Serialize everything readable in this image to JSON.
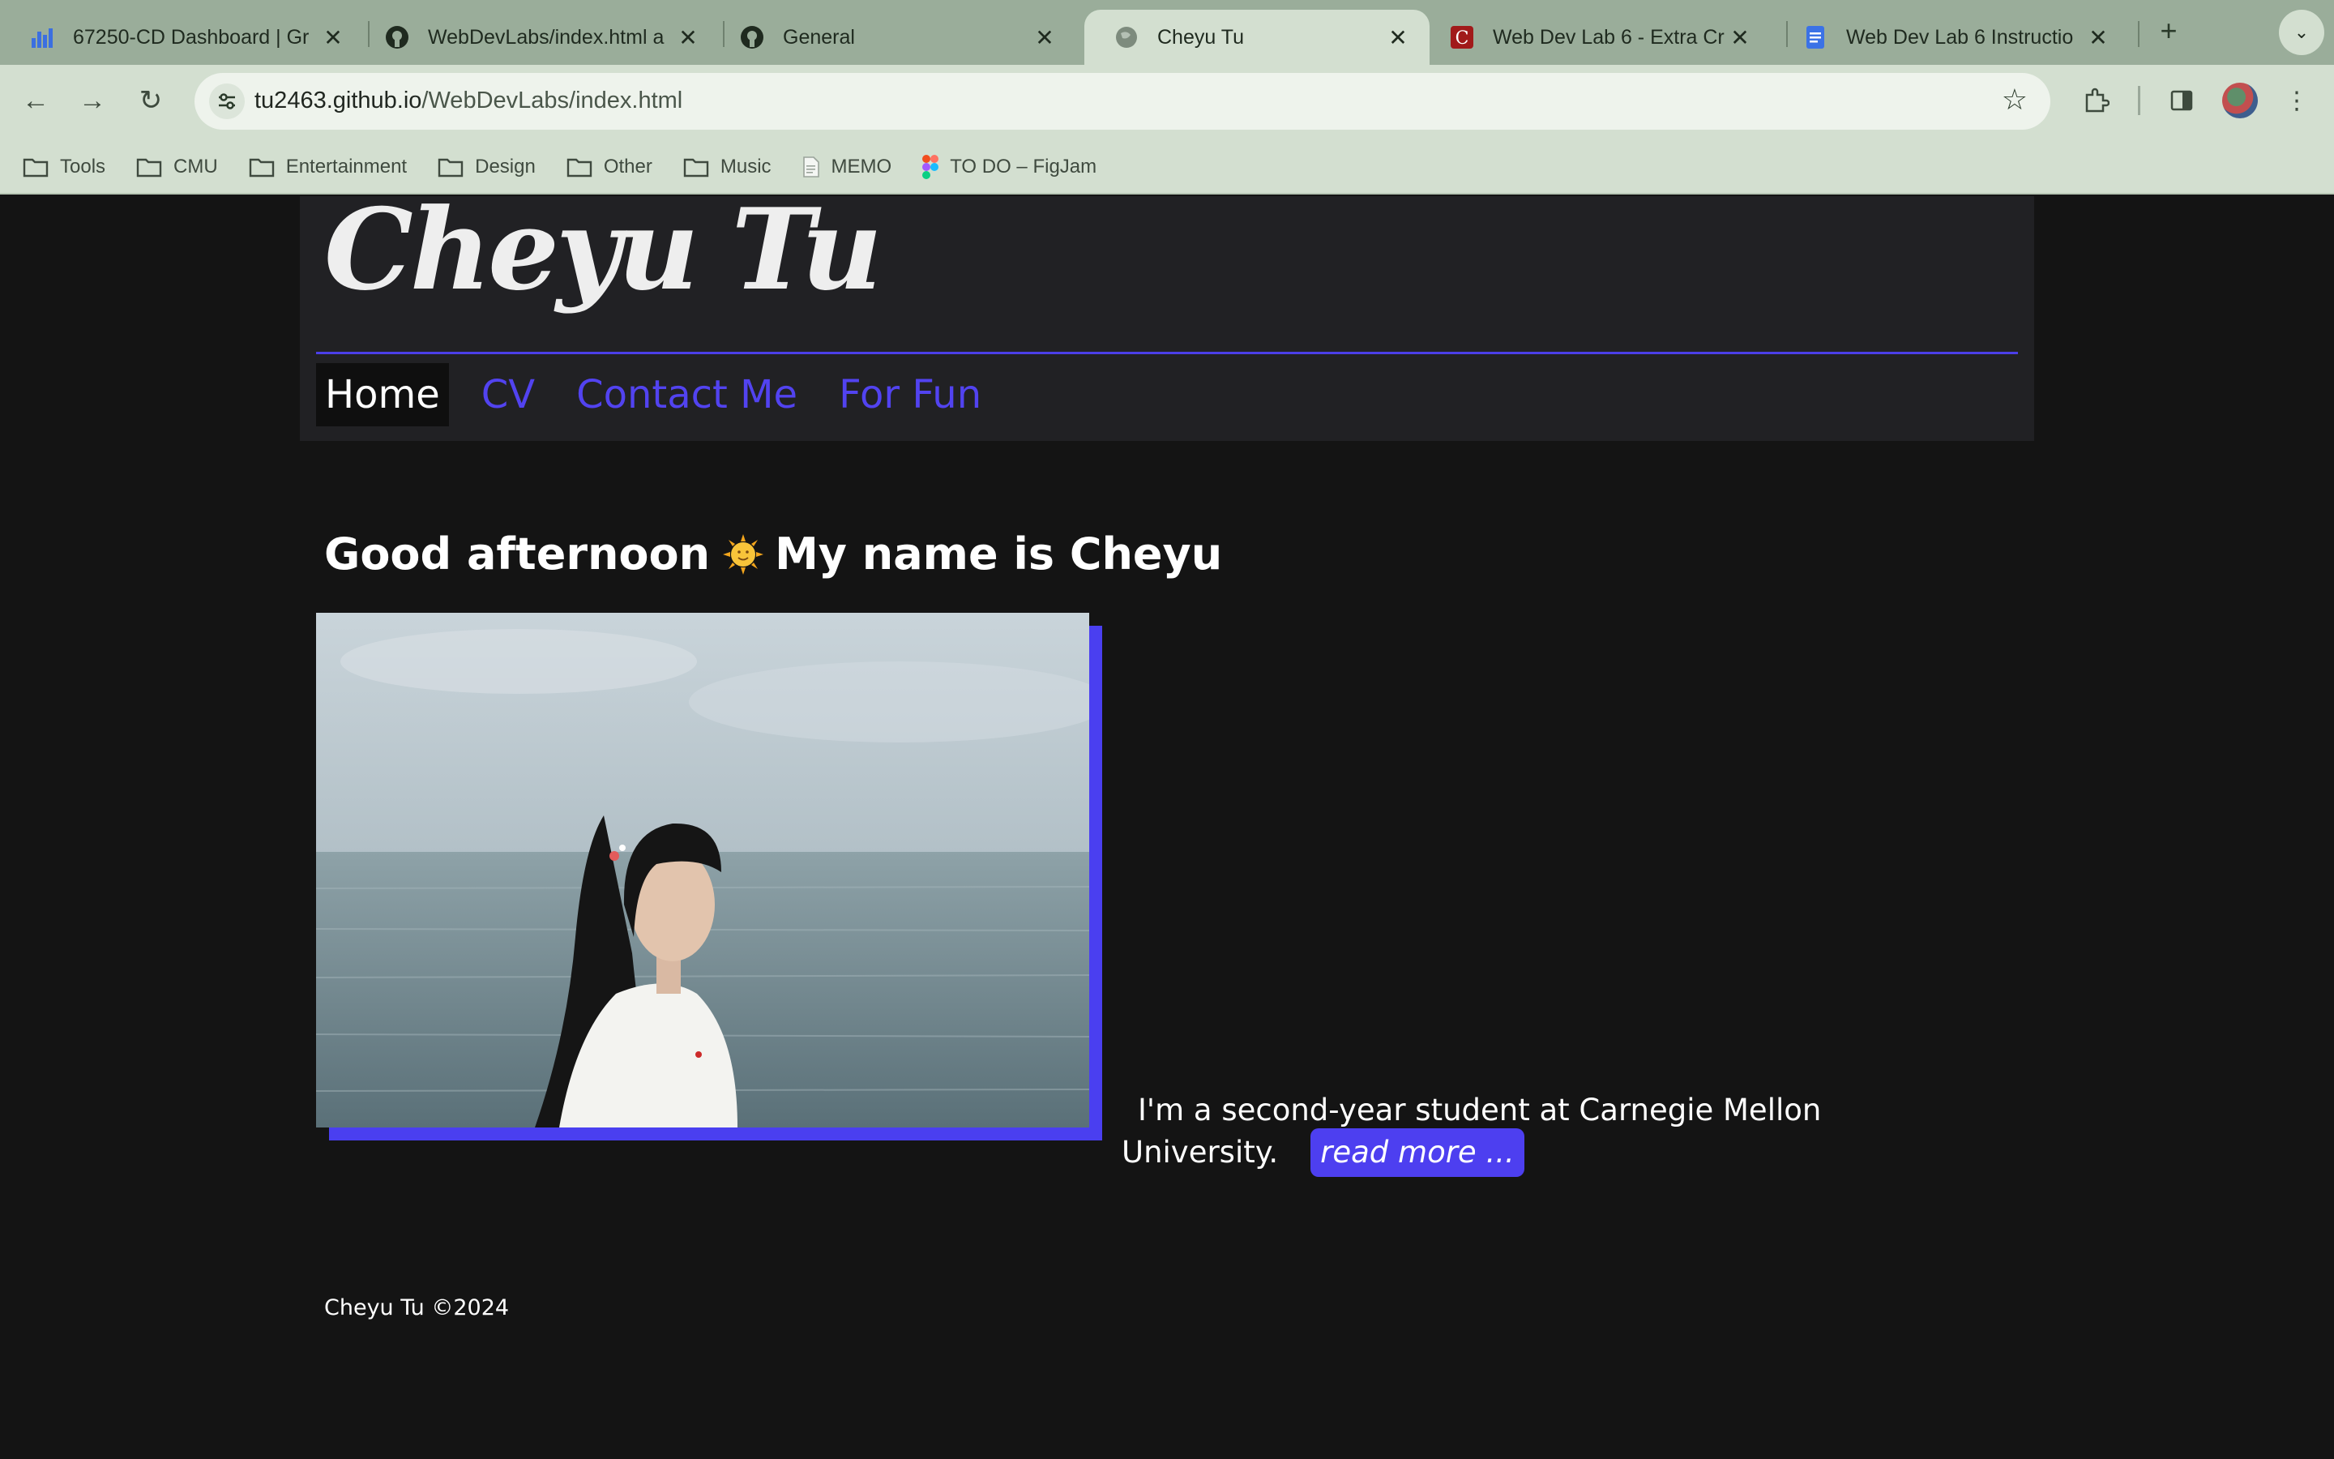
{
  "browser": {
    "tabs": [
      {
        "title": "67250-CD Dashboard | Gr",
        "icon": "bar-chart-icon"
      },
      {
        "title": "WebDevLabs/index.html a",
        "icon": "github-icon"
      },
      {
        "title": "General",
        "icon": "github-icon"
      },
      {
        "title": "Cheyu Tu",
        "icon": "globe-icon",
        "active": true
      },
      {
        "title": "Web Dev Lab 6 - Extra Cr",
        "icon": "canvas-icon"
      },
      {
        "title": "Web Dev Lab 6 Instructio",
        "icon": "docs-icon"
      }
    ],
    "url_host": "tu2463.github.io",
    "url_path": "/WebDevLabs/index.html",
    "bookmarks": [
      {
        "label": "Tools",
        "icon": "folder-icon"
      },
      {
        "label": "CMU",
        "icon": "folder-icon"
      },
      {
        "label": "Entertainment",
        "icon": "folder-icon"
      },
      {
        "label": "Design",
        "icon": "folder-icon"
      },
      {
        "label": "Other",
        "icon": "folder-icon"
      },
      {
        "label": "Music",
        "icon": "folder-icon"
      },
      {
        "label": "MEMO",
        "icon": "file-icon"
      },
      {
        "label": "TO DO – FigJam",
        "icon": "figma-icon"
      }
    ]
  },
  "site": {
    "logo": "Cheyu Tu",
    "nav": [
      {
        "label": "Home",
        "current": true
      },
      {
        "label": "CV"
      },
      {
        "label": "Contact Me"
      },
      {
        "label": "For Fun"
      }
    ],
    "greeting_part1": "Good afternoon",
    "greeting_part2": "My name is Cheyu",
    "bio_line1": "I'm a second-year student at Carnegie Mellon",
    "bio_line2": "University.",
    "read_more": "read more ...",
    "footer": "Cheyu Tu ©2024"
  },
  "colors": {
    "accent": "#4d3ff0",
    "page_bg": "#141414",
    "header_bg": "#212124",
    "chrome_frame": "#9aad9a",
    "chrome_toolbar": "#d3dfd0"
  }
}
